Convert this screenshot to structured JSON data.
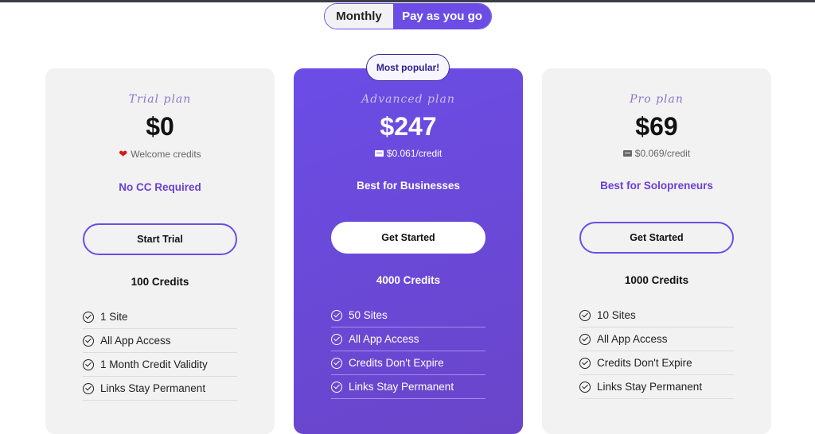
{
  "toggle": {
    "options": [
      "Monthly",
      "Pay as you go"
    ],
    "selected": "Pay as you go"
  },
  "badge": "Most popular!",
  "colors": {
    "accent": "#6b4de6",
    "card_bg": "#f2f2f2",
    "heart": "#d9161c"
  },
  "plans": [
    {
      "name": "Trial plan",
      "price": "$0",
      "sub_icon": "heart-icon",
      "sub": "Welcome credits",
      "tag": "No CC Required",
      "button": "Start Trial",
      "credits": "100 Credits",
      "features": [
        "1 Site",
        "All App Access",
        "1 Month Credit Validity",
        "Links Stay Permanent"
      ]
    },
    {
      "name": "Advanced plan",
      "price": "$247",
      "sub_icon": "credit-card-icon",
      "sub": "$0.061/credit",
      "tag": "Best for Businesses",
      "button": "Get Started",
      "credits": "4000 Credits",
      "features": [
        "50 Sites",
        "All App Access",
        "Credits Don't Expire",
        "Links Stay Permanent"
      ]
    },
    {
      "name": "Pro plan",
      "price": "$69",
      "sub_icon": "credit-card-icon",
      "sub": "$0.069/credit",
      "tag": "Best for Solopreneurs",
      "button": "Get Started",
      "credits": "1000 Credits",
      "features": [
        "10 Sites",
        "All App Access",
        "Credits Don't Expire",
        "Links Stay Permanent"
      ]
    }
  ]
}
